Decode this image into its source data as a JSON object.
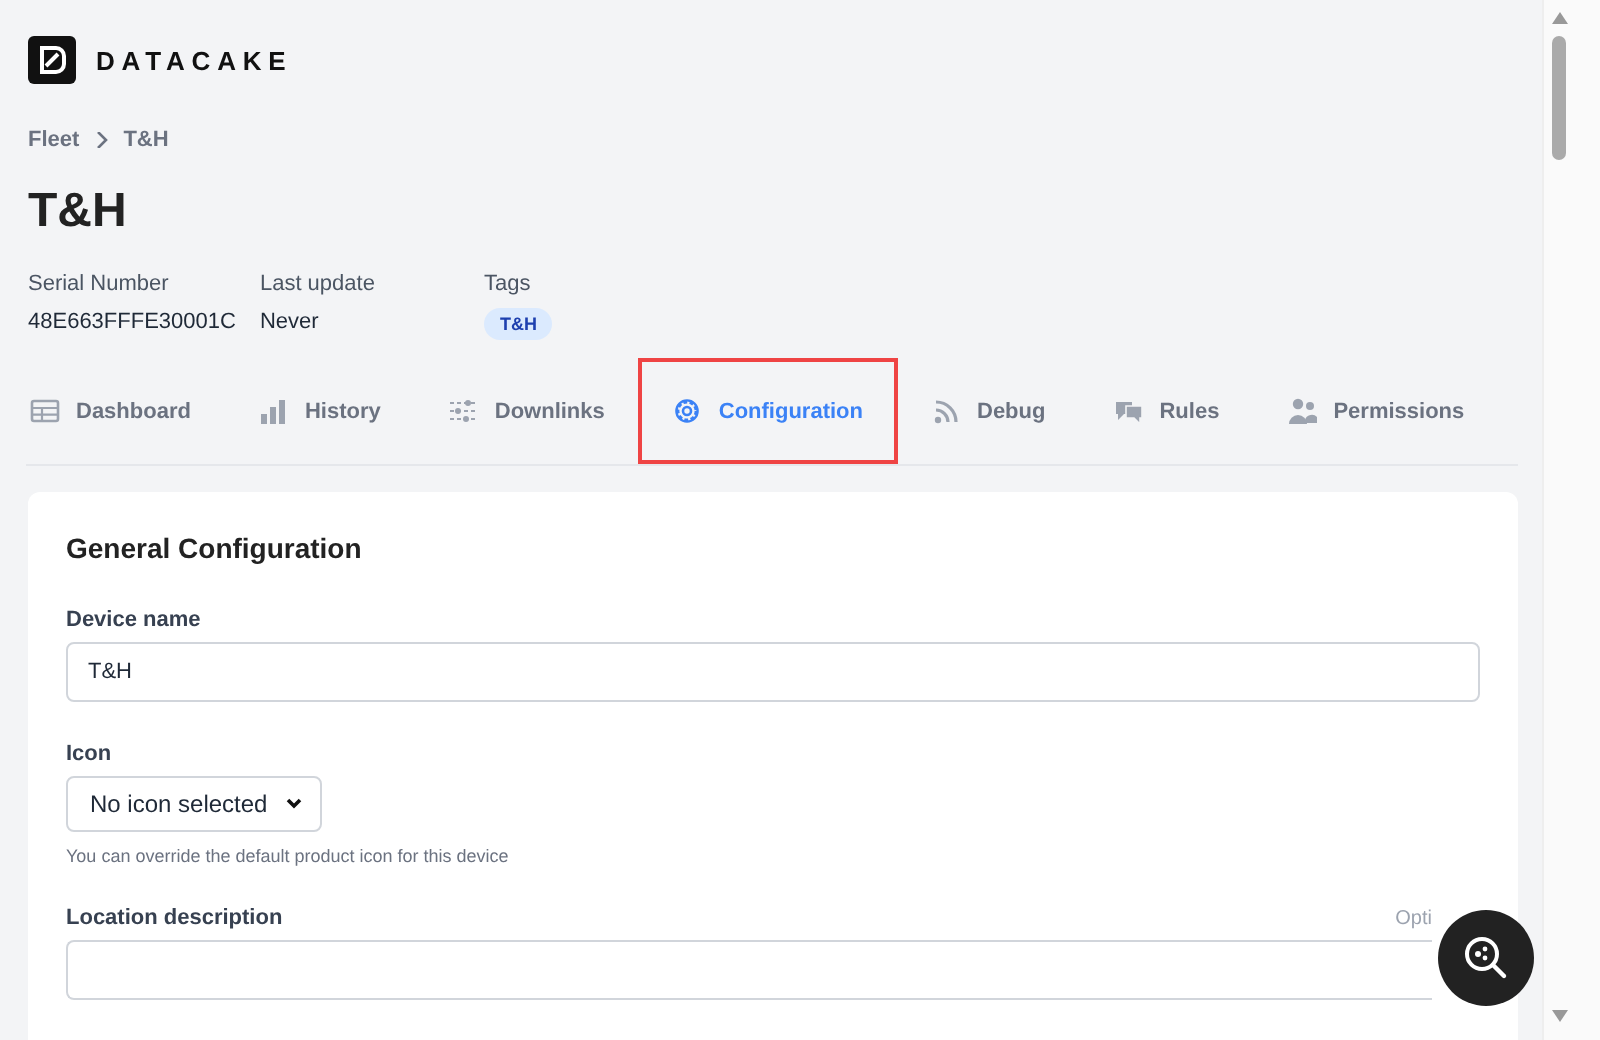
{
  "logo": {
    "text": "DATACAKE"
  },
  "breadcrumb": [
    {
      "label": "Fleet"
    },
    {
      "label": "T&H"
    }
  ],
  "title": "T&H",
  "meta": [
    {
      "label": "Serial Number",
      "value": "48E663FFFE30001C",
      "kind": "text"
    },
    {
      "label": "Last update",
      "value": "Never",
      "kind": "text"
    },
    {
      "label": "Tags",
      "value": "T&H",
      "kind": "tag"
    }
  ],
  "tabs": [
    {
      "label": "Dashboard",
      "selected": false,
      "highlighted": false
    },
    {
      "label": "History",
      "selected": false,
      "highlighted": false
    },
    {
      "label": "Downlinks",
      "selected": false,
      "highlighted": false
    },
    {
      "label": "Configuration",
      "selected": true,
      "highlighted": true
    },
    {
      "label": "Debug",
      "selected": false,
      "highlighted": false
    },
    {
      "label": "Rules",
      "selected": false,
      "highlighted": false
    },
    {
      "label": "Permissions",
      "selected": false,
      "highlighted": false
    }
  ],
  "card": {
    "title": "General Configuration",
    "fields": [
      {
        "kind": "input",
        "label": "Device name",
        "value": "T&H"
      },
      {
        "kind": "select",
        "label": "Icon",
        "value": "No icon selected",
        "help": "You can override the default product icon for this device"
      },
      {
        "kind": "input",
        "label": "Location description",
        "note": "Opti"
      }
    ]
  }
}
